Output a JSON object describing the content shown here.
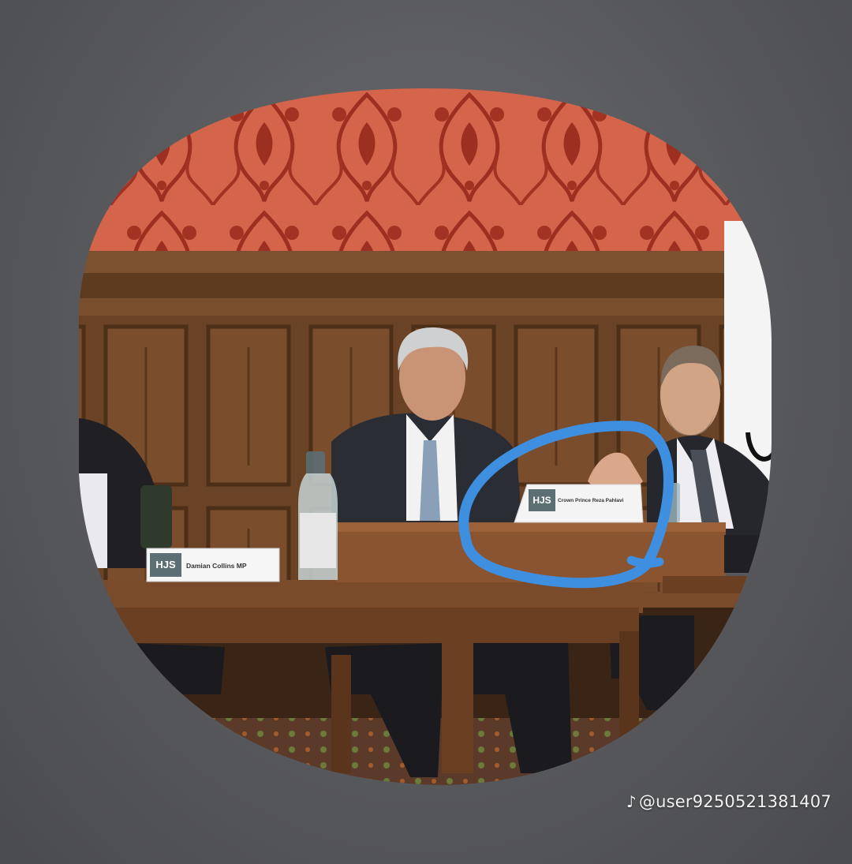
{
  "photo": {
    "placards": {
      "left": {
        "logo": "HJS",
        "name": "Damian Collins MP"
      },
      "center": {
        "logo": "HJS",
        "name": "Crown Prince Reza Pahlavi"
      }
    }
  },
  "watermark": {
    "icon": "tiktok-note-icon",
    "handle": "@user9250521381407"
  },
  "colors": {
    "highlight_circle": "#3f8fe0",
    "wallpaper": "#c8563f",
    "panelling": "#6b4326"
  }
}
